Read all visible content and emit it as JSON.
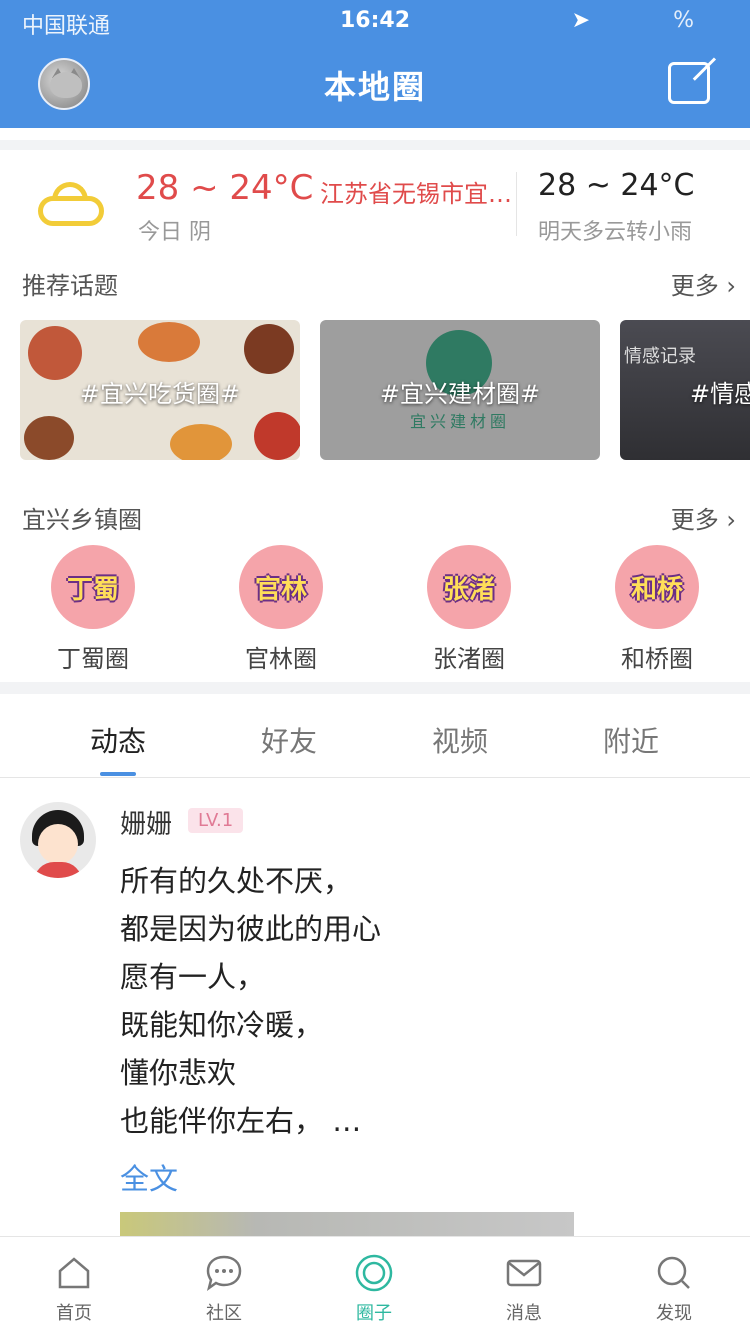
{
  "status_bar": {
    "carrier": "中国联通",
    "time": "16:42",
    "battery": "%"
  },
  "header": {
    "title": "本地圈"
  },
  "weather": {
    "today_temp": "28 ~ 24°C",
    "city": "江苏省无锡市宜…",
    "today_desc": "今日 阴",
    "tomorrow_temp": "28 ~ 24°C",
    "tomorrow_desc": "明天多云转小雨"
  },
  "topics": {
    "title": "推荐话题",
    "more": "更多 ›",
    "items": [
      {
        "label": "#宜兴吃货圈#"
      },
      {
        "label": "#宜兴建材圈#",
        "sub": "宜兴建材圈"
      },
      {
        "label": "#情感",
        "hand": "情感记录"
      }
    ]
  },
  "towns": {
    "title": "宜兴乡镇圈",
    "more": "更多 ›",
    "items": [
      {
        "badge": "丁蜀",
        "name": "丁蜀圈"
      },
      {
        "badge": "官林",
        "name": "官林圈"
      },
      {
        "badge": "张渚",
        "name": "张渚圈"
      },
      {
        "badge": "和桥",
        "name": "和桥圈"
      }
    ]
  },
  "tabs": [
    {
      "label": "动态",
      "active": true
    },
    {
      "label": "好友",
      "active": false
    },
    {
      "label": "视频",
      "active": false
    },
    {
      "label": "附近",
      "active": false
    }
  ],
  "post": {
    "user": "姗姗",
    "level": "LV.1",
    "lines": [
      "所有的久处不厌，",
      "都是因为彼此的用心",
      "愿有一人，",
      "既能知你冷暖，",
      "懂你悲欢",
      "也能伴你左右，  …"
    ],
    "more": "全文"
  },
  "bottom_nav": [
    {
      "label": "首页",
      "icon": "home-icon"
    },
    {
      "label": "社区",
      "icon": "chat-bubble-icon"
    },
    {
      "label": "圈子",
      "icon": "circle-icon",
      "active": true
    },
    {
      "label": "消息",
      "icon": "mail-icon"
    },
    {
      "label": "发现",
      "icon": "search-icon"
    }
  ],
  "colors": {
    "brand_blue": "#4a90e2",
    "warn_red": "#e04b4b",
    "active_teal": "#2eb8a0"
  }
}
